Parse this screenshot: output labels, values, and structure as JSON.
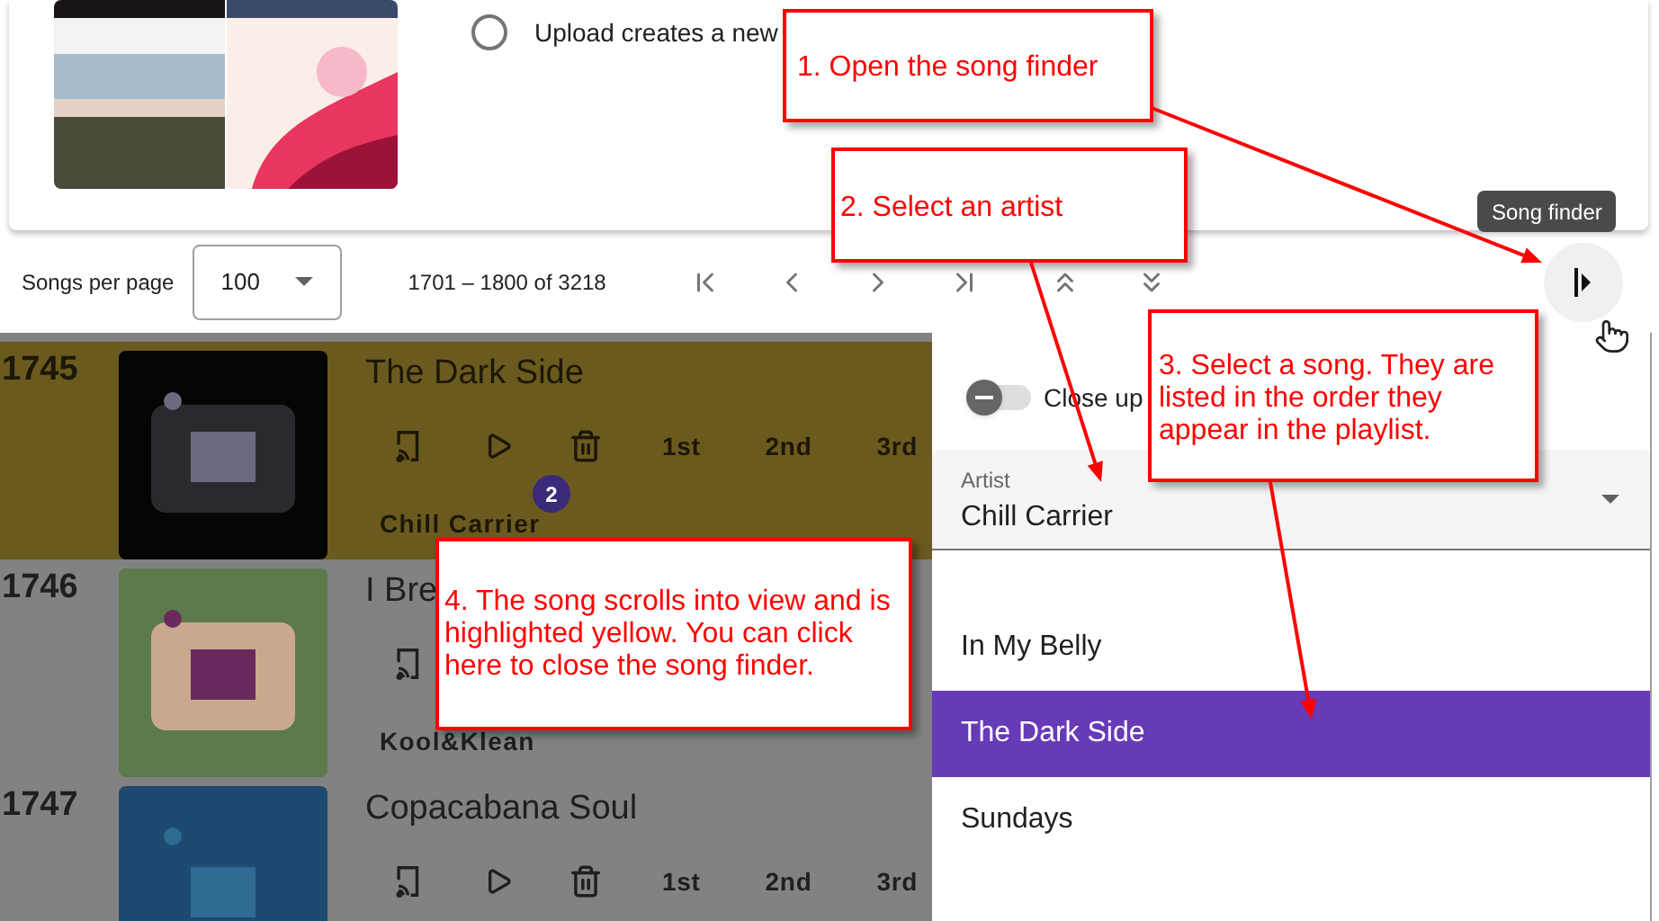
{
  "top_card": {
    "radio": {
      "label": "Upload creates a new",
      "selected": false
    }
  },
  "toolbar": {
    "per_page_label": "Songs per page",
    "per_page_value": "100",
    "range": "1701 – 1800 of 3218"
  },
  "tooltip": "Song finder",
  "songs": [
    {
      "number": "1745",
      "title": "The Dark Side",
      "artist": "Chill Carrier",
      "ranks": [
        "1st",
        "2nd",
        "3rd"
      ],
      "badge": "2",
      "highlighted": true
    },
    {
      "number": "1746",
      "title": "I Bre",
      "artist": "Kool&Klean",
      "highlighted": false
    },
    {
      "number": "1747",
      "title": "Copacabana Soul",
      "ranks": [
        "1st",
        "2nd",
        "3rd"
      ],
      "highlighted": false
    }
  ],
  "drawer": {
    "toggle": {
      "label": "Close up",
      "on": false
    },
    "artist": {
      "label": "Artist",
      "value": "Chill Carrier"
    },
    "songs": [
      {
        "title": "In My Belly",
        "selected": false
      },
      {
        "title": "The Dark Side",
        "selected": true
      },
      {
        "title": "Sundays",
        "selected": false
      }
    ]
  },
  "callouts": [
    {
      "text": "1. Open the song finder"
    },
    {
      "text": "2. Select an artist"
    },
    {
      "text": "3. Select a song.  They are listed in the order they appear in the playlist."
    },
    {
      "text": "4.  The song scrolls into view and is highlighted yellow.  You can click here to close the song finder."
    }
  ]
}
